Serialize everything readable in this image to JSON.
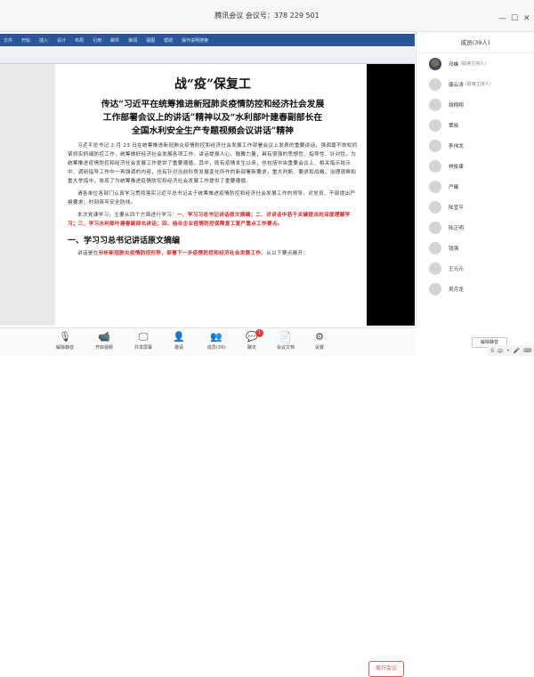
{
  "window": {
    "title": "腾讯会议 会议号：378 229 501"
  },
  "ribbon": {
    "tabs": [
      "文件",
      "开始",
      "插入",
      "设计",
      "布局",
      "引用",
      "邮件",
      "审阅",
      "视图",
      "帮助",
      "操作说明搜索"
    ]
  },
  "document": {
    "title": "战“疫”保复工",
    "subtitle_lines": [
      "传达“习近平在统筹推进新冠肺炎疫情防控和经济社会发展",
      "工作部署会议上的讲话”精神以及“水利部叶建春副部长在",
      "全国水利安全生产专题视频会议讲话”精神"
    ],
    "para1": "习近平总书记 2 月 23 日在统筹推进新冠肺炎疫情防控和经济社会发展工作部署会议上发表的重要讲话，强调毫不放松抓紧抓实抓细防控工作，统筹做好经济社会发展各项工作。讲话提振人心、鼓舞力量，具有很强的思想性、指导性、针对性，为统筹推进疫情防控和经济社会发展工作提供了重要遵循。其中，既有疫情发生以来，也包括中央重要会议上、相关指示批示中、调研指导工作中一再强调的内容，也有针对当前形势发展变化所作的新部署新要求，重大判断、要求和战略、治理观察和重大举措中，体现了为统筹推进疫情防控和经济社会发展工作提供了重要遵循。",
    "para2": "请各单位各部门认真学习贯彻落实习近平总书记关于统筹推进疫情防控和经济社会发展工作的领导，对党员、干部提出严格要求，时刻筑牢安全防线。",
    "para3_prefix": "本次党课学习，主要从四个方面进行学习：",
    "para3_red": "一、学习习总书记讲话原文摘编；二、对讲话中若干关键提法的深度理解学习；三、学习水利部叶建春副部长讲话；四、结合企业疫情防控保障复工复产重点工作要点。",
    "section1": "一、学习习总书记讲话原文摘编",
    "para4_prefix": "讲话是在",
    "para4_red": "分析新冠肺炎疫情防控形势，部署下一步疫情防控和经济社会发展工作",
    "para4_suffix": "。从以下要点展开："
  },
  "sidebar": {
    "header": "成员(39人)",
    "members": [
      {
        "name": "邓峰",
        "note": "(联席主持人)",
        "photo": true
      },
      {
        "name": "康云涛",
        "note": "(联席主持人)",
        "photo": false
      },
      {
        "name": "胡翔翔",
        "note": "",
        "photo": false
      },
      {
        "name": "覃晓",
        "note": "",
        "photo": false
      },
      {
        "name": "李伟龙",
        "note": "",
        "photo": false
      },
      {
        "name": "林俊康",
        "note": "",
        "photo": false
      },
      {
        "name": "严曦",
        "note": "",
        "photo": false
      },
      {
        "name": "陆宜平",
        "note": "",
        "photo": false
      },
      {
        "name": "陆正明",
        "note": "",
        "photo": false
      },
      {
        "name": "钱强",
        "note": "",
        "photo": false
      },
      {
        "name": "王元元",
        "note": "",
        "photo": false
      },
      {
        "name": "吴月龙",
        "note": "",
        "photo": false
      }
    ],
    "mute_all": "解除静音"
  },
  "toolbar": {
    "buttons": [
      {
        "label": "解除静音",
        "icon": "microphone-icon",
        "glyph": "🎙"
      },
      {
        "label": "开启视频",
        "icon": "camera-icon",
        "glyph": "📹"
      },
      {
        "label": "共享屏幕",
        "icon": "share-screen-icon",
        "glyph": "🖵"
      },
      {
        "label": "邀请",
        "icon": "invite-icon",
        "glyph": "👤"
      },
      {
        "label": "成员(39)",
        "icon": "members-icon",
        "glyph": "👥"
      },
      {
        "label": "聊天",
        "icon": "chat-icon",
        "glyph": "💬"
      },
      {
        "label": "会议文档",
        "icon": "document-icon",
        "glyph": "📄"
      },
      {
        "label": "设置",
        "icon": "settings-icon",
        "glyph": "⚙"
      }
    ],
    "chat_badge": "1",
    "leave": "离开会议"
  },
  "tray": {
    "ime": "中",
    "glyphs": [
      "S",
      "中",
      "•",
      "🎤",
      "⌨"
    ]
  },
  "colors": {
    "ribbon": "#2b579a",
    "red_text": "#dd2222",
    "leave": "#e05a5a"
  }
}
